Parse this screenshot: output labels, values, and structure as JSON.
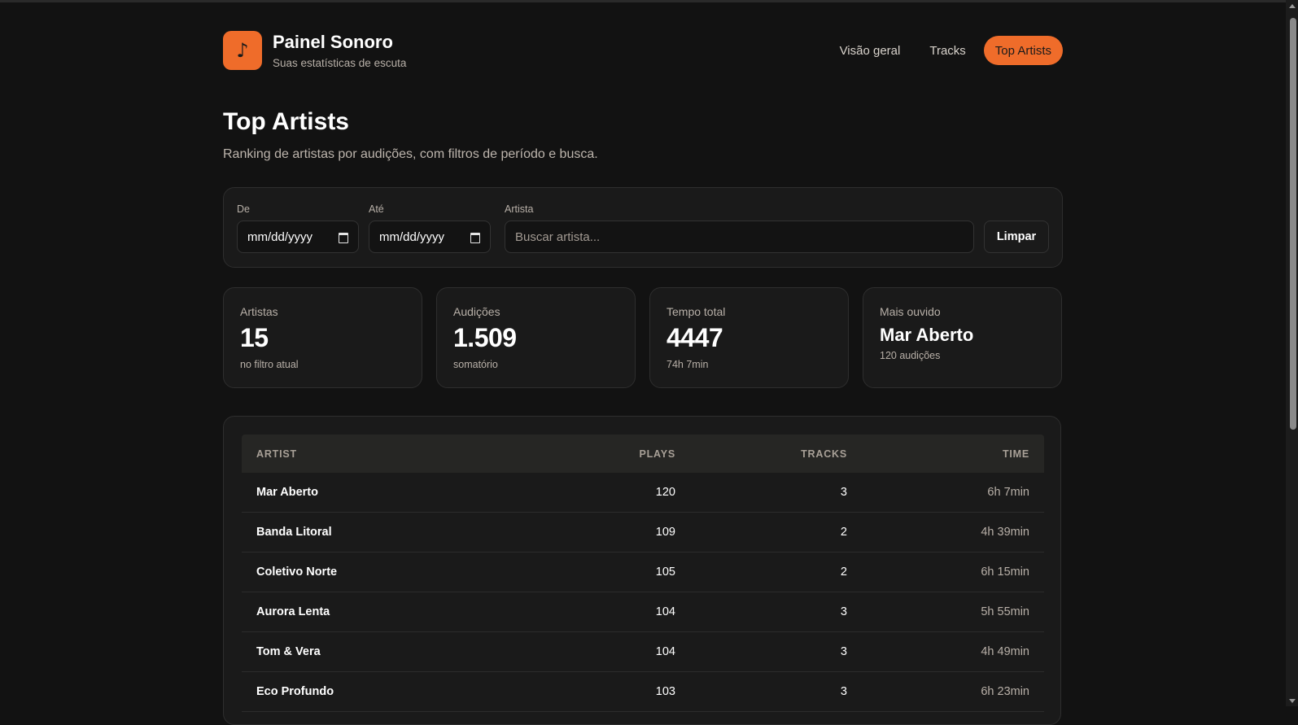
{
  "brand": {
    "icon": "music-note-icon",
    "glyph": "♪",
    "title": "Painel Sonoro",
    "subtitle": "Suas estatísticas de escuta"
  },
  "nav": {
    "items": [
      {
        "label": "Visão geral",
        "active": false
      },
      {
        "label": "Tracks",
        "active": false
      },
      {
        "label": "Top Artists",
        "active": true
      }
    ]
  },
  "page": {
    "title": "Top Artists",
    "description": "Ranking de artistas por audições, com filtros de período e busca."
  },
  "filters": {
    "from_label": "De",
    "from_value": "mm/dd/yyyy",
    "to_label": "Até",
    "to_value": "mm/dd/yyyy",
    "artist_label": "Artista",
    "artist_placeholder": "Buscar artista...",
    "clear_label": "Limpar"
  },
  "stats": [
    {
      "label": "Artistas",
      "value": "15",
      "note": "no filtro atual"
    },
    {
      "label": "Audições",
      "value": "1.509",
      "note": "somatório"
    },
    {
      "label": "Tempo total",
      "value": "4447",
      "note": "74h 7min"
    },
    {
      "label": "Mais ouvido",
      "value": "Mar Aberto",
      "note": "120 audições"
    }
  ],
  "table": {
    "headers": {
      "artist": "ARTIST",
      "plays": "PLAYS",
      "tracks": "TRACKS",
      "time": "TIME"
    },
    "rows": [
      {
        "artist": "Mar Aberto",
        "plays": "120",
        "tracks": "3",
        "time": "6h 7min"
      },
      {
        "artist": "Banda Litoral",
        "plays": "109",
        "tracks": "2",
        "time": "4h 39min"
      },
      {
        "artist": "Coletivo Norte",
        "plays": "105",
        "tracks": "2",
        "time": "6h 15min"
      },
      {
        "artist": "Aurora Lenta",
        "plays": "104",
        "tracks": "3",
        "time": "5h 55min"
      },
      {
        "artist": "Tom & Vera",
        "plays": "104",
        "tracks": "3",
        "time": "4h 49min"
      },
      {
        "artist": "Eco Profundo",
        "plays": "103",
        "tracks": "3",
        "time": "6h 23min"
      }
    ]
  },
  "colors": {
    "accent": "#ef6c2a",
    "background": "#121212",
    "card": "#1a1a1a"
  }
}
